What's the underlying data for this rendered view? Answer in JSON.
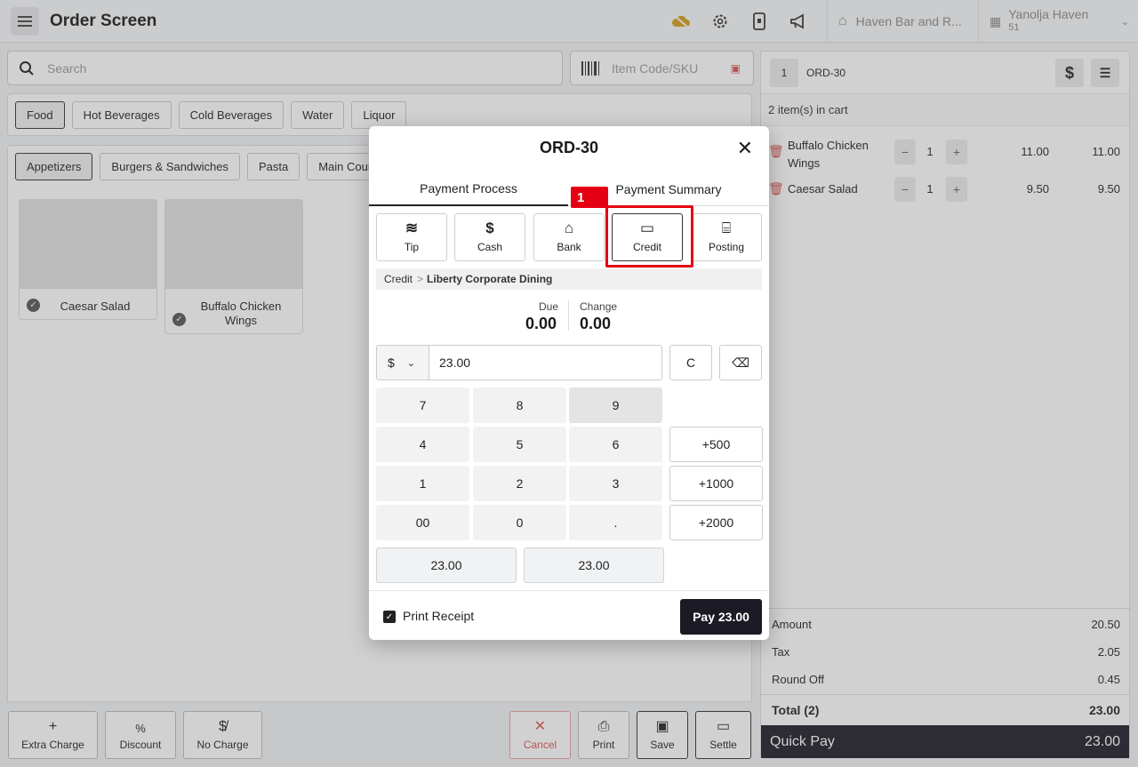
{
  "header": {
    "title": "Order Screen",
    "store_name": "Haven Bar and R...",
    "user_name": "Yanolja Haven",
    "user_sub": "51"
  },
  "search": {
    "placeholder": "Search",
    "code_placeholder": "Item Code/SKU"
  },
  "categories": [
    "Food",
    "Hot Beverages",
    "Cold Beverages",
    "Water",
    "Liquor"
  ],
  "subcategories": [
    "Appetizers",
    "Burgers & Sandwiches",
    "Pasta",
    "Main Course"
  ],
  "products": [
    {
      "name": "Caesar Salad"
    },
    {
      "name": "Buffalo Chicken Wings"
    }
  ],
  "bottom_actions": {
    "extra_charge": "Extra Charge",
    "discount": "Discount",
    "no_charge": "No Charge",
    "cancel": "Cancel",
    "print": "Print",
    "save": "Save",
    "settle": "Settle"
  },
  "cart": {
    "table_no": "1",
    "order_id": "ORD-30",
    "count_text": "2 item(s) in cart",
    "items": [
      {
        "name": "Buffalo Chicken Wings",
        "qty": "1",
        "price": "11.00",
        "total": "11.00"
      },
      {
        "name": "Caesar Salad",
        "qty": "1",
        "price": "9.50",
        "total": "9.50"
      }
    ],
    "totals": {
      "amount_label": "Amount",
      "amount": "20.50",
      "tax_label": "Tax",
      "tax": "2.05",
      "roundoff_label": "Round Off",
      "roundoff": "0.45",
      "total_label": "Total (2)",
      "total": "23.00"
    },
    "quickpay_label": "Quick Pay",
    "quickpay_value": "23.00"
  },
  "modal": {
    "title": "ORD-30",
    "tabs": [
      "Payment Process",
      "Payment Summary"
    ],
    "payment_types": [
      "Tip",
      "Cash",
      "Bank",
      "Credit",
      "Posting"
    ],
    "highlight_badge": "1",
    "crumb_root": "Credit",
    "crumb_sep": ">",
    "crumb_leaf": "Liberty Corporate Dining",
    "due_label": "Due",
    "due_value": "0.00",
    "change_label": "Change",
    "change_value": "0.00",
    "currency": "$",
    "amount": "23.00",
    "clear_label": "C",
    "keys": [
      "7",
      "8",
      "9",
      "4",
      "5",
      "6",
      "1",
      "2",
      "3",
      "00",
      "0",
      "."
    ],
    "add_keys": [
      "+500",
      "+1000",
      "+2000"
    ],
    "quick_amounts": [
      "23.00",
      "23.00"
    ],
    "print_receipt": "Print Receipt",
    "pay_label": "Pay 23.00"
  }
}
